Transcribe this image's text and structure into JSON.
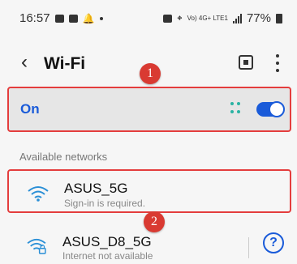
{
  "status_bar": {
    "time": "16:57",
    "network_text": "Vo) 4G+ LTE1",
    "battery": "77%"
  },
  "header": {
    "title": "Wi-Fi",
    "back_icon": "chevron-left-icon",
    "qr_icon": "qr-code-icon",
    "more_icon": "more-vertical-icon"
  },
  "annotations": {
    "badge1": "1",
    "badge2": "2"
  },
  "wifi_toggle": {
    "label": "On",
    "state": true,
    "accent": "#1a5bd9"
  },
  "section": {
    "available": "Available networks"
  },
  "networks": [
    {
      "ssid": "ASUS_5G",
      "status": "Sign-in is required."
    },
    {
      "ssid": "ASUS_D8_5G",
      "status": "Internet not available",
      "help": "?"
    }
  ],
  "colors": {
    "highlight": "#e43d3d",
    "badge": "#d93a32",
    "accent": "#1a5bd9"
  }
}
